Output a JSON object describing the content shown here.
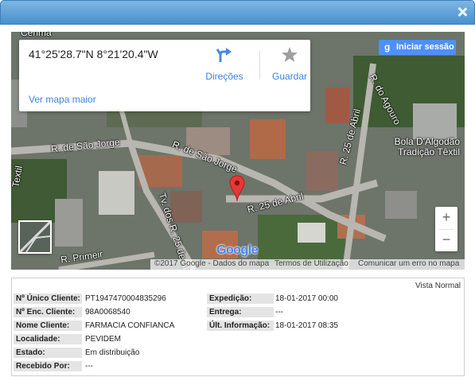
{
  "window": {
    "close_icon": "close-icon"
  },
  "map": {
    "coordinates": "41°25'28.7\"N 8°21'20.4\"W",
    "directions_label": "Direções",
    "save_label": "Guardar",
    "view_larger": "Ver mapa maior",
    "signin_label": "Iniciar sessão",
    "signin_g": "g",
    "roads": {
      "top_left": "Cerima",
      "sao_jorge_1": "R. de São Jorge",
      "sao_jorge_2": "R. de São Jorge",
      "textil": "Textil",
      "abril_1": "R. 25 de Abril",
      "abril_2": "R. 25 de Abril",
      "tv_abril": "Tv. dos R. 25 de Abril",
      "primeiro": "R. Primeir",
      "agouro": "R. do Agouro"
    },
    "place_name_1": "Bola D'Algodão",
    "place_name_2": "Tradição Têxtil",
    "zoom_in": "+",
    "zoom_out": "−",
    "logo": "Google",
    "attribution": "©2017 Google - Dados do mapa",
    "terms": "Termos de Utilização",
    "report": "Comunicar um erro no mapa"
  },
  "details": {
    "view_mode": "Vista Normal",
    "left": [
      {
        "label": "Nº Único Cliente:",
        "value": "PT1947470004835296"
      },
      {
        "label": "Nº Enc. Cliente:",
        "value": "98A0068540"
      },
      {
        "label": "Nome Cliente:",
        "value": "FARMACIA CONFIANCA"
      },
      {
        "label": "Localidade:",
        "value": "PEVIDEM"
      },
      {
        "label": "Estado:",
        "value": "Em distribuição"
      },
      {
        "label": "Recebido Por:",
        "value": "---"
      }
    ],
    "right": [
      {
        "label": "Expedição:",
        "value": "18-01-2017 00:00"
      },
      {
        "label": "Entrega:",
        "value": "---"
      },
      {
        "label": "Últ. Informação:",
        "value": "18-01-2017 08:35"
      }
    ]
  },
  "colors": {
    "accent": "#4a90cc",
    "link": "#3a84df",
    "pin": "#e53935",
    "signin": "#4d90fe"
  }
}
